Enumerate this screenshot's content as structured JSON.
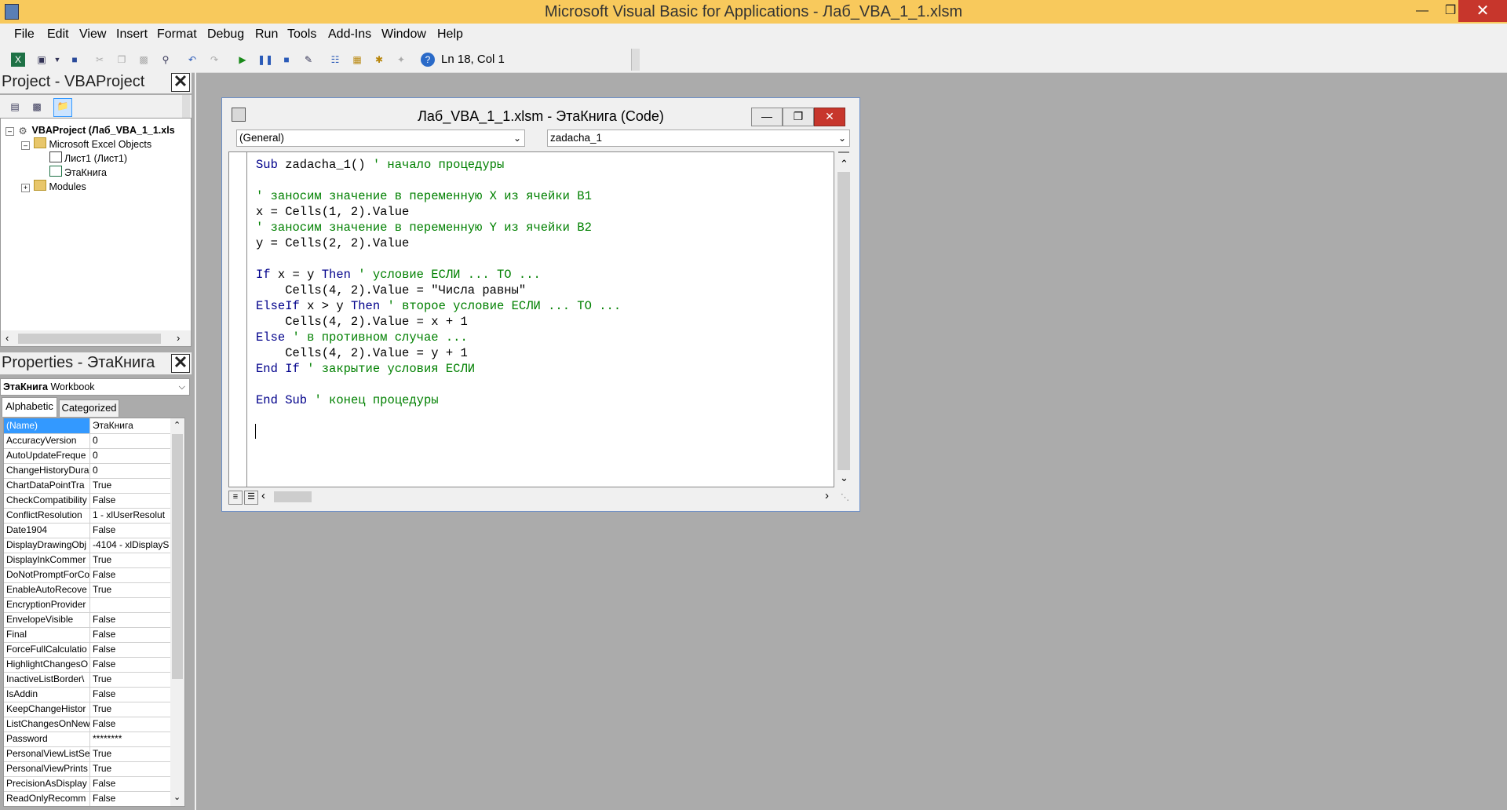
{
  "window": {
    "title": "Microsoft Visual Basic for Applications - Лаб_VBA_1_1.xlsm"
  },
  "menu": [
    "File",
    "Edit",
    "View",
    "Insert",
    "Format",
    "Debug",
    "Run",
    "Tools",
    "Add-Ins",
    "Window",
    "Help"
  ],
  "toolbar": {
    "status": "Ln 18, Col 1"
  },
  "project": {
    "title": "Project - VBAProject",
    "tree": [
      {
        "label": "VBAProject (Лаб_VBA_1_1.xls",
        "bold": true
      },
      {
        "label": "Microsoft Excel Objects"
      },
      {
        "label": "Лист1 (Лист1)"
      },
      {
        "label": "ЭтаКнига"
      },
      {
        "label": "Modules"
      }
    ]
  },
  "properties": {
    "title": "Properties - ЭтаКнига",
    "object_name": "ЭтаКнига",
    "object_type": "Workbook",
    "tabs": [
      "Alphabetic",
      "Categorized"
    ],
    "rows": [
      {
        "name": "(Name)",
        "value": "ЭтаКнига"
      },
      {
        "name": "AccuracyVersion",
        "value": "0"
      },
      {
        "name": "AutoUpdateFreque",
        "value": "0"
      },
      {
        "name": "ChangeHistoryDura",
        "value": "0"
      },
      {
        "name": "ChartDataPointTra",
        "value": "True"
      },
      {
        "name": "CheckCompatibility",
        "value": "False"
      },
      {
        "name": "ConflictResolution",
        "value": "1 - xlUserResolut"
      },
      {
        "name": "Date1904",
        "value": "False"
      },
      {
        "name": "DisplayDrawingObj",
        "value": "-4104 - xlDisplayS"
      },
      {
        "name": "DisplayInkCommer",
        "value": "True"
      },
      {
        "name": "DoNotPromptForCo",
        "value": "False"
      },
      {
        "name": "EnableAutoRecove",
        "value": "True"
      },
      {
        "name": "EncryptionProvider",
        "value": ""
      },
      {
        "name": "EnvelopeVisible",
        "value": "False"
      },
      {
        "name": "Final",
        "value": "False"
      },
      {
        "name": "ForceFullCalculatio",
        "value": "False"
      },
      {
        "name": "HighlightChangesO",
        "value": "False"
      },
      {
        "name": "InactiveListBorder\\",
        "value": "True"
      },
      {
        "name": "IsAddin",
        "value": "False"
      },
      {
        "name": "KeepChangeHistor",
        "value": "True"
      },
      {
        "name": "ListChangesOnNew",
        "value": "False"
      },
      {
        "name": "Password",
        "value": "********"
      },
      {
        "name": "PersonalViewListSe",
        "value": "True"
      },
      {
        "name": "PersonalViewPrints",
        "value": "True"
      },
      {
        "name": "PrecisionAsDisplay",
        "value": "False"
      },
      {
        "name": "ReadOnlyRecomm",
        "value": "False"
      }
    ]
  },
  "code_window": {
    "title": "Лаб_VBA_1_1.xlsm - ЭтаКнига (Code)",
    "object_combo": "(General)",
    "proc_combo": "zadacha_1",
    "lines": [
      "Sub zadacha_1() ' начало процедуры",
      "",
      "' заносим значение в переменную X из ячейки B1",
      "x = Cells(1, 2).Value",
      "' заносим значение в переменную Y из ячейки B2",
      "y = Cells(2, 2).Value",
      "",
      "If x = y Then ' условие ЕСЛИ ... ТО ...",
      "    Cells(4, 2).Value = \"Числа равны\"",
      "ElseIf x > y Then ' второе условие ЕСЛИ ... ТО ...",
      "    Cells(4, 2).Value = x + 1",
      "Else ' в противном случае ...",
      "    Cells(4, 2).Value = y + 1",
      "End If ' закрытие условия ЕСЛИ",
      "",
      "End Sub ' конец процедуры"
    ]
  }
}
